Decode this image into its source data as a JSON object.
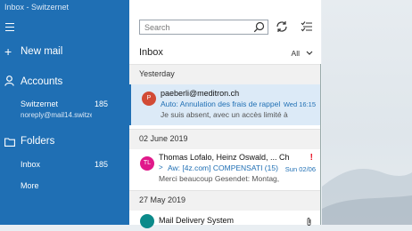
{
  "window": {
    "title": "Inbox - Switzernet"
  },
  "sidebar": {
    "new_mail": "New mail",
    "accounts_heading": "Accounts",
    "account": {
      "name": "Switzernet",
      "count": "185",
      "email": "noreply@mail14.switzer..."
    },
    "folders_heading": "Folders",
    "folder_inbox": {
      "name": "Inbox",
      "count": "185"
    },
    "more": "More"
  },
  "mail": {
    "search_placeholder": "Search",
    "title": "Inbox",
    "filter_label": "All",
    "groups": [
      "Yesterday",
      "02 June 2019",
      "27 May 2019"
    ],
    "messages": [
      {
        "initials": "P",
        "from": "paeberli@meditron.ch",
        "subject": "Auto: Annulation des frais de rappel",
        "preview": "Je suis absent, avec un accès limité à",
        "date": "Wed 16:15",
        "avatar_color": "#d24b36"
      },
      {
        "initials": "TL",
        "from": "Thomas Lofalo, Heinz Oswald, ... Ch",
        "subject": "Aw: [4z.com] COMPENSATI (15)",
        "preview": "Merci beaucoup Gesendet: Montag,",
        "date": "Sun 02/06",
        "avatar_color": "#e0198a",
        "flag": "!"
      },
      {
        "initials": "",
        "from": "Mail Delivery System",
        "subject": "",
        "preview": "",
        "date": "",
        "avatar_color": "#0b8a8a"
      }
    ]
  }
}
